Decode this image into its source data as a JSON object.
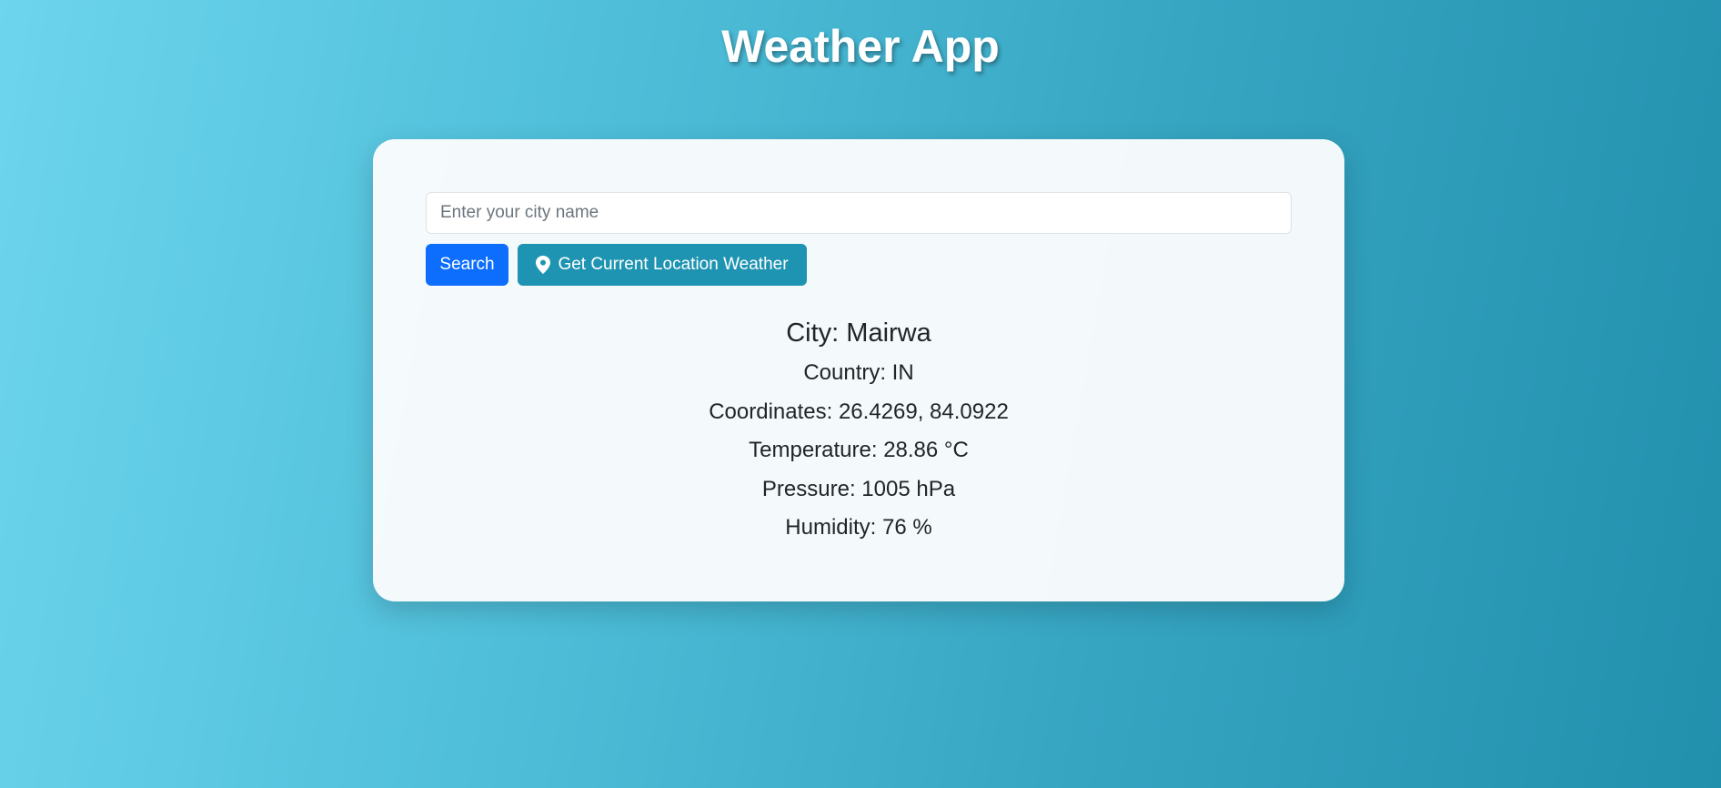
{
  "header": {
    "title": "Weather App"
  },
  "search": {
    "placeholder": "Enter your city name",
    "value": "",
    "search_label": "Search",
    "location_label": "Get Current Location Weather",
    "location_icon": "map-pin-icon"
  },
  "weather": {
    "city": "City: Mairwa",
    "country": "Country: IN",
    "coordinates": "Coordinates: 26.4269, 84.0922",
    "temperature": "Temperature: 28.86 °C",
    "pressure": "Pressure: 1005 hPa",
    "humidity": "Humidity: 76 %"
  },
  "colors": {
    "primary_button": "#0d6efd",
    "info_button": "#1f94b2",
    "gradient_start": "#6dd5ed",
    "gradient_end": "#2190ad"
  }
}
